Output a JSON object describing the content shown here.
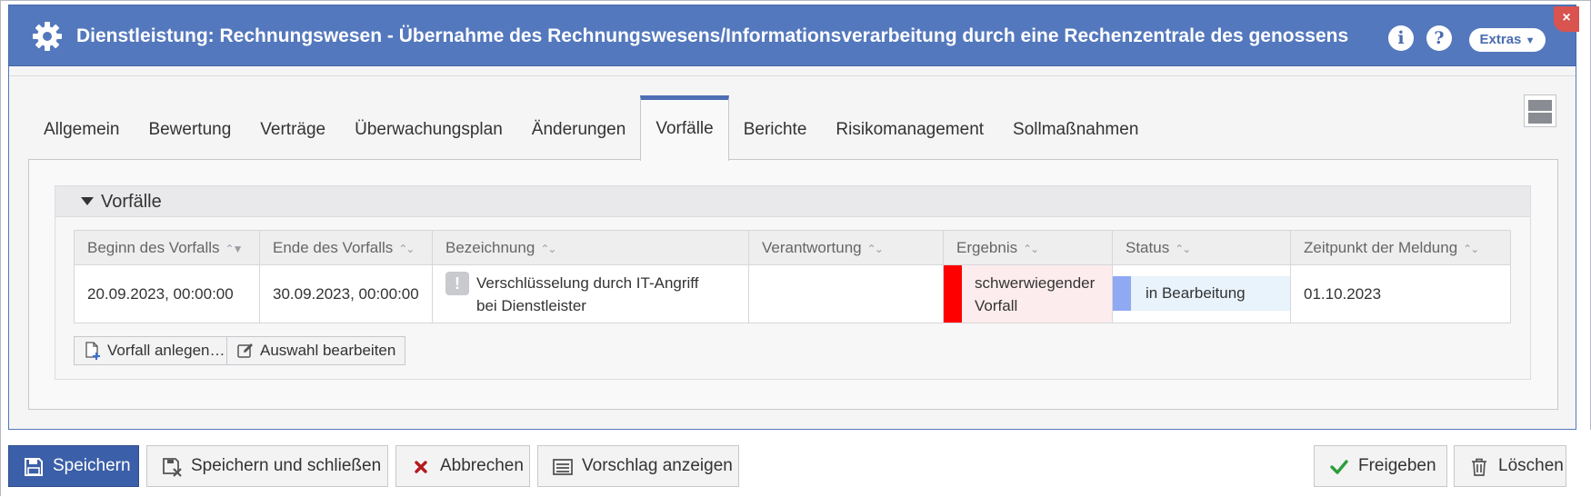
{
  "dialog": {
    "title": "Dienstleistung: Rechnungswesen - Übernahme des Rechnungswesens/Informationsverarbeitung durch eine Rechenzentrale des genossenscha…",
    "info_label": "i",
    "help_label": "?",
    "extras_label": "Extras",
    "close_label": "×"
  },
  "tabs": [
    "Allgemein",
    "Bewertung",
    "Verträge",
    "Überwachungsplan",
    "Änderungen",
    "Vorfälle",
    "Berichte",
    "Risikomanagement",
    "Sollmaßnahmen"
  ],
  "active_tab": "Vorfälle",
  "panel": {
    "title": "Vorfälle",
    "columns": [
      "Beginn des Vorfalls",
      "Ende des Vorfalls",
      "Bezeichnung",
      "Verantwortung",
      "Ergebnis",
      "Status",
      "Zeitpunkt der Meldung"
    ],
    "rows": [
      {
        "begin": "20.09.2023, 00:00:00",
        "end": "30.09.2023, 00:00:00",
        "desc_line1": "Verschlüsselung durch IT-Angriff",
        "desc_line2": "bei Dienstleister",
        "responsibility": "",
        "result_line1": "schwerwiegender",
        "result_line2": "Vorfall",
        "status": "in Bearbeitung",
        "reported": "01.10.2023"
      }
    ],
    "add_button": "Vorfall anlegen…",
    "edit_button": "Auswahl bearbeiten"
  },
  "footer": {
    "save": "Speichern",
    "save_close": "Speichern und schließen",
    "cancel": "Abbrechen",
    "show_proposal": "Vorschlag anzeigen",
    "approve": "Freigeben",
    "delete": "Löschen"
  },
  "colors": {
    "header_blue": "#5478bd",
    "result_red": "#ff0000",
    "status_blue": "#8fa9f3"
  }
}
